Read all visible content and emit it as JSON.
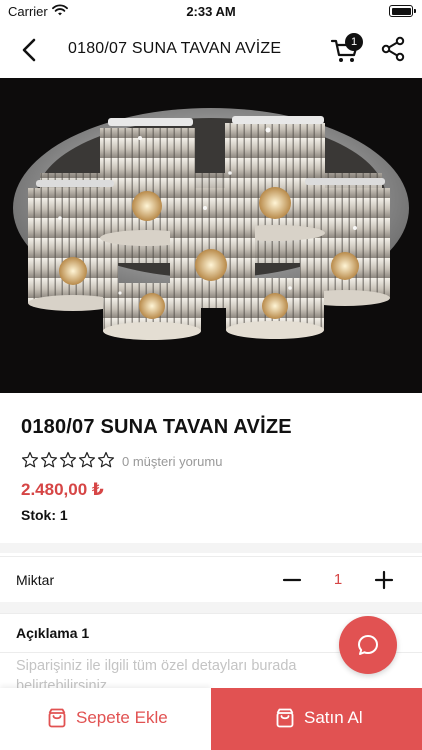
{
  "status_bar": {
    "carrier": "Carrier",
    "time": "2:33 AM"
  },
  "nav": {
    "title": "0180/07 SUNA TAVAN AVİZE",
    "cart_count": "1"
  },
  "product": {
    "name": "0180/07 SUNA TAVAN AVİZE",
    "rating_stars": 0,
    "reviews_text": "0 müşteri yorumu",
    "price": "2.480,00 ₺",
    "stock_text": "Stok: 1"
  },
  "quantity": {
    "label": "Miktar",
    "value": "1"
  },
  "description": {
    "heading": "Açıklama 1",
    "placeholder": "Siparişiniz ile ilgili tüm özel detayları burada belirtebilirsiniz"
  },
  "actions": {
    "add_to_cart": "Sepete Ekle",
    "buy": "Satın Al"
  },
  "colors": {
    "accent": "#e15252",
    "price": "#d64545",
    "image_bg": "#0d0c0c"
  },
  "icons": [
    "wifi-icon",
    "battery-icon",
    "back-arrow-icon",
    "cart-icon",
    "share-icon",
    "star-outline-icon",
    "minus-icon",
    "plus-icon",
    "chat-icon",
    "shopping-bag-icon"
  ]
}
